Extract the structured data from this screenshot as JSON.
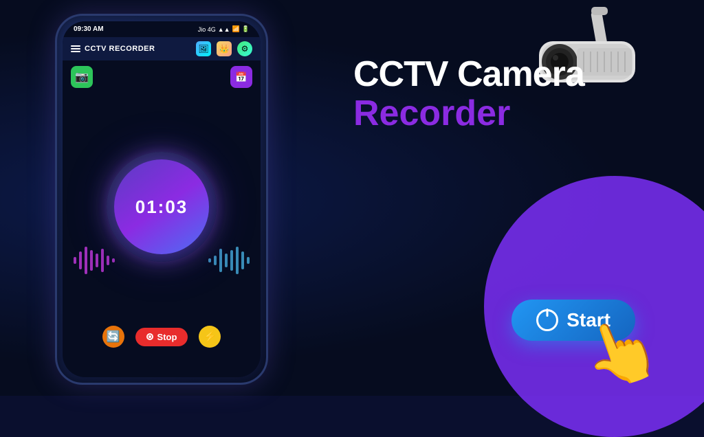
{
  "app": {
    "title": "CCTV RECORDER",
    "status_time": "09:30 AM",
    "status_network": "Jio 4G"
  },
  "heading": {
    "line1": "CCTV Camera",
    "line2": "Recorder"
  },
  "timer": {
    "display": "01:03"
  },
  "buttons": {
    "stop_label": "Stop",
    "start_label": "Start"
  },
  "icons": {
    "hamburger": "≡",
    "gallery": "🖼",
    "crown": "👑",
    "settings": "⚙",
    "camera_green": "📷",
    "widget_purple": "📅",
    "rotate": "🔄",
    "lightning": "⚡",
    "power": "⏻"
  }
}
